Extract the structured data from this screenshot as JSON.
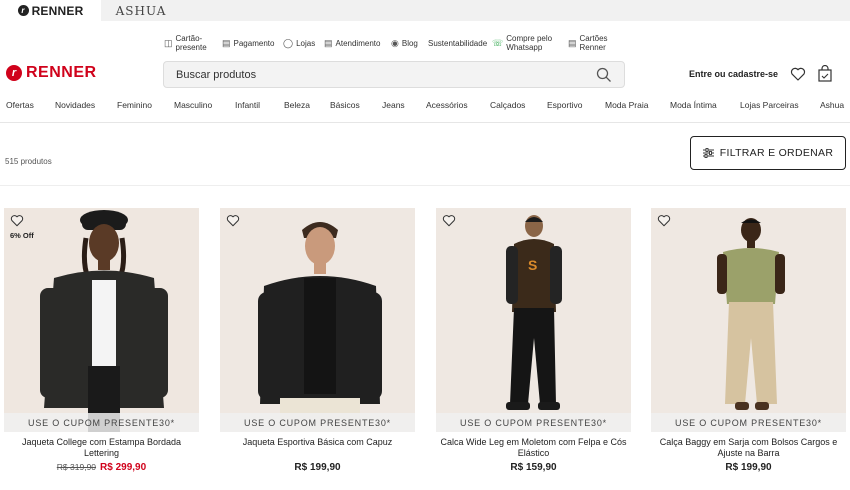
{
  "brand_tabs": [
    "RENNER",
    "ASHUA"
  ],
  "utility_links": [
    {
      "label": "Cartão-\npresente",
      "icon": "gift-icon"
    },
    {
      "label": "Pagamento",
      "icon": "card-icon"
    },
    {
      "label": "Lojas",
      "icon": "store-icon"
    },
    {
      "label": "Atendimento",
      "icon": "chat-icon"
    },
    {
      "label": "Blog",
      "icon": "blog-icon"
    },
    {
      "label": "Sustentabilidade",
      "icon": ""
    },
    {
      "label": "Compre pelo\nWhatsapp",
      "icon": "whatsapp-icon"
    },
    {
      "label": "Cartões\nRenner",
      "icon": "card-icon"
    }
  ],
  "header": {
    "logo": "RENNER",
    "search_placeholder": "Buscar produtos",
    "login": "Entre ou cadastre-se"
  },
  "nav": [
    "Ofertas",
    "Novidades",
    "Feminino",
    "Masculino",
    "Infantil",
    "Beleza",
    "Básicos",
    "Jeans",
    "Acessórios",
    "Calçados",
    "Esportivo",
    "Moda Praia",
    "Moda Íntima",
    "Lojas Parceiras",
    "Ashua"
  ],
  "results": {
    "count": "515 produtos",
    "filter_label": "FILTRAR E ORDENAR"
  },
  "products": [
    {
      "name": "Jaqueta College com Estampa Bordada Lettering",
      "old_price": "R$ 319,90",
      "price": "R$ 299,90",
      "badge": "6% Off",
      "coupon": "USE O CUPOM PRESENTE30*"
    },
    {
      "name": "Jaqueta Esportiva Básica com Capuz",
      "old_price": "",
      "price": "R$ 199,90",
      "badge": "",
      "coupon": "USE O CUPOM PRESENTE30*"
    },
    {
      "name": "Calca Wide Leg em Moletom com Felpa e Cós Elástico",
      "old_price": "",
      "price": "R$ 159,90",
      "badge": "",
      "coupon": "USE O CUPOM PRESENTE30*"
    },
    {
      "name": "Calça Baggy em Sarja com Bolsos Cargos e Ajuste na Barra",
      "old_price": "",
      "price": "R$ 199,90",
      "badge": "",
      "coupon": "USE O CUPOM PRESENTE30*"
    }
  ],
  "colors": {
    "brand_red": "#d0021b",
    "whatsapp_green": "#25a244"
  }
}
